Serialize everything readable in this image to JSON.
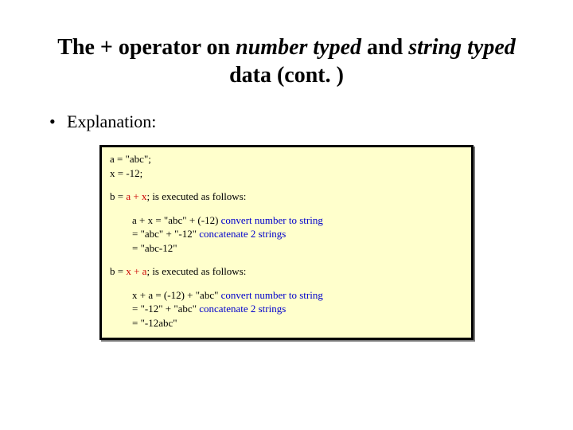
{
  "title": {
    "t1": "The + operator on ",
    "t2": "number typed",
    "t3": " and ",
    "t4": "string typed",
    "t5": " data (cont. )"
  },
  "bullet1": "Explanation:",
  "code": {
    "assign": {
      "l1": "a = \"abc\";",
      "l2": "x = -12;"
    },
    "ex1": {
      "lhs": "b = ",
      "expr": "a + x",
      "tail": ";   is executed as follows:",
      "step1_expr": "a + x = \"abc\" + (-12)",
      "step1_note": "    convert number to string",
      "step2_expr": "= \"abc\" + \"-12\"",
      "step2_note": "    concatenate 2 strings",
      "step3_expr": "= \"abc-12\""
    },
    "ex2": {
      "lhs": "b = ",
      "expr": "x + a",
      "tail": ";   is executed as follows:",
      "step1_expr": "x + a = (-12) + \"abc\"",
      "step1_note": "    convert number to string",
      "step2_expr": "= \"-12\" + \"abc\"",
      "step2_note": "    concatenate 2 strings",
      "step3_expr": "= \"-12abc\""
    }
  }
}
